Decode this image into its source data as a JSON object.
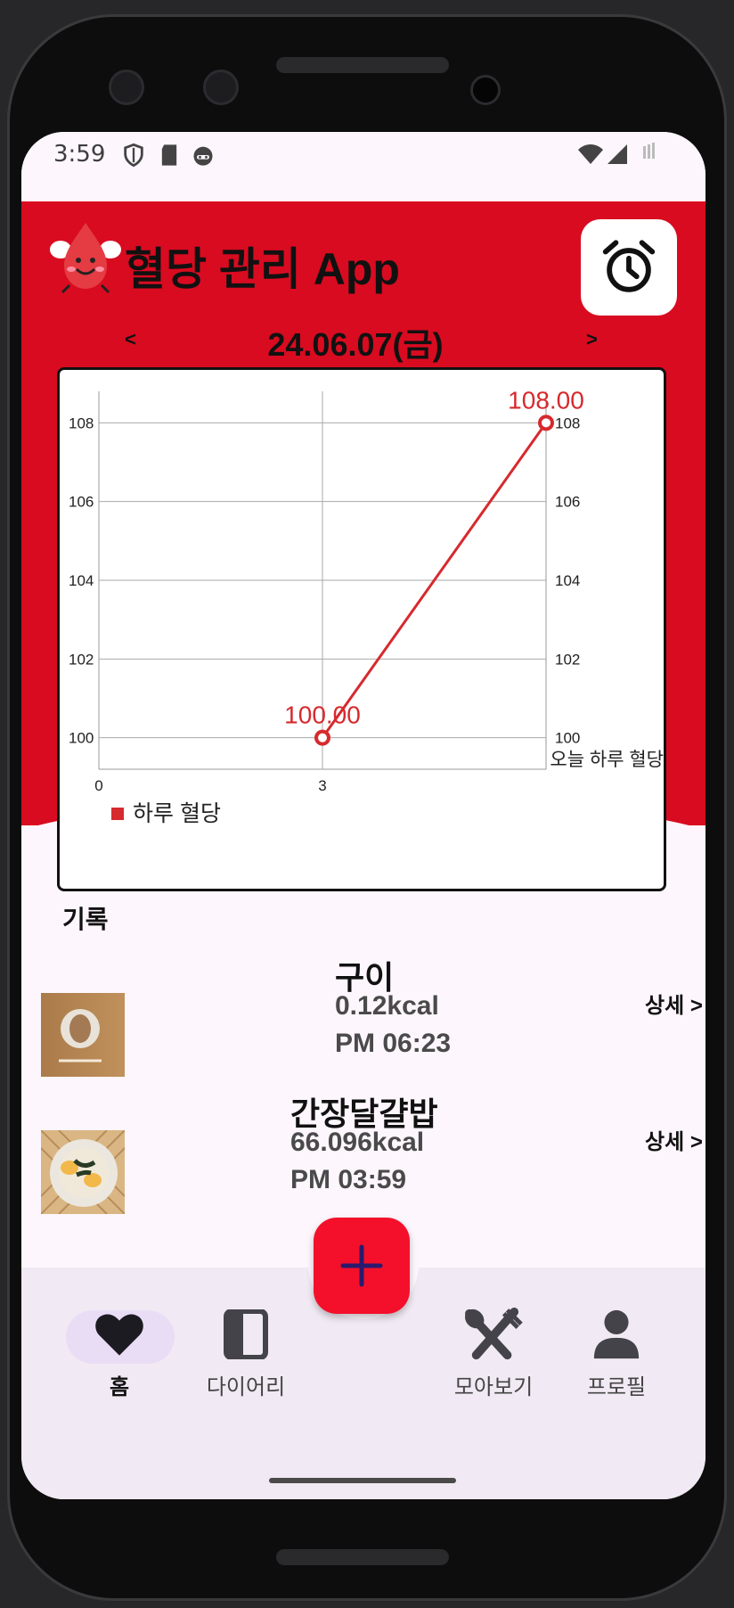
{
  "statusbar": {
    "time": "3:59"
  },
  "header": {
    "title": "혈당 관리 App",
    "date": "24.06.07(금)",
    "prev": "<",
    "next": ">"
  },
  "chart_data": {
    "type": "line",
    "x": [
      3,
      6
    ],
    "series": [
      {
        "name": "하루 혈당",
        "values": [
          100,
          108
        ],
        "labels": [
          "100.00",
          "108.00"
        ],
        "color": "#d62a2e"
      }
    ],
    "x_ticks": [
      "0",
      "3"
    ],
    "x_tick_values": [
      0,
      3
    ],
    "y_ticks": [
      "100",
      "102",
      "104",
      "106",
      "108"
    ],
    "y_tick_values": [
      100,
      102,
      104,
      106,
      108
    ],
    "xlim": [
      0,
      6
    ],
    "ylim": [
      99.2,
      108.8
    ],
    "description": "오늘 하루 혈당 ",
    "legend": "bottom-left",
    "grid": true
  },
  "section": {
    "records_label": "기록"
  },
  "records": [
    {
      "name": "구이",
      "kcal": "0.12kcal",
      "time": "PM 06:23",
      "detail": "상세 >"
    },
    {
      "name": "간장달걀밥",
      "kcal": "66.096kcal",
      "time": "PM 03:59",
      "detail": "상세 >"
    }
  ],
  "nav": {
    "fab": "+",
    "items": [
      {
        "label": "홈",
        "icon": "heart-icon",
        "active": true
      },
      {
        "label": "다이어리",
        "icon": "diary-icon",
        "active": false
      },
      {
        "label": "모아보기",
        "icon": "utensils-icon",
        "active": false
      },
      {
        "label": "프로필",
        "icon": "person-icon",
        "active": false
      }
    ]
  },
  "colors": {
    "accent": "#d90b20",
    "fab": "#f4102a",
    "line": "#d62a2e",
    "nav_bg": "#f1e9f3"
  }
}
